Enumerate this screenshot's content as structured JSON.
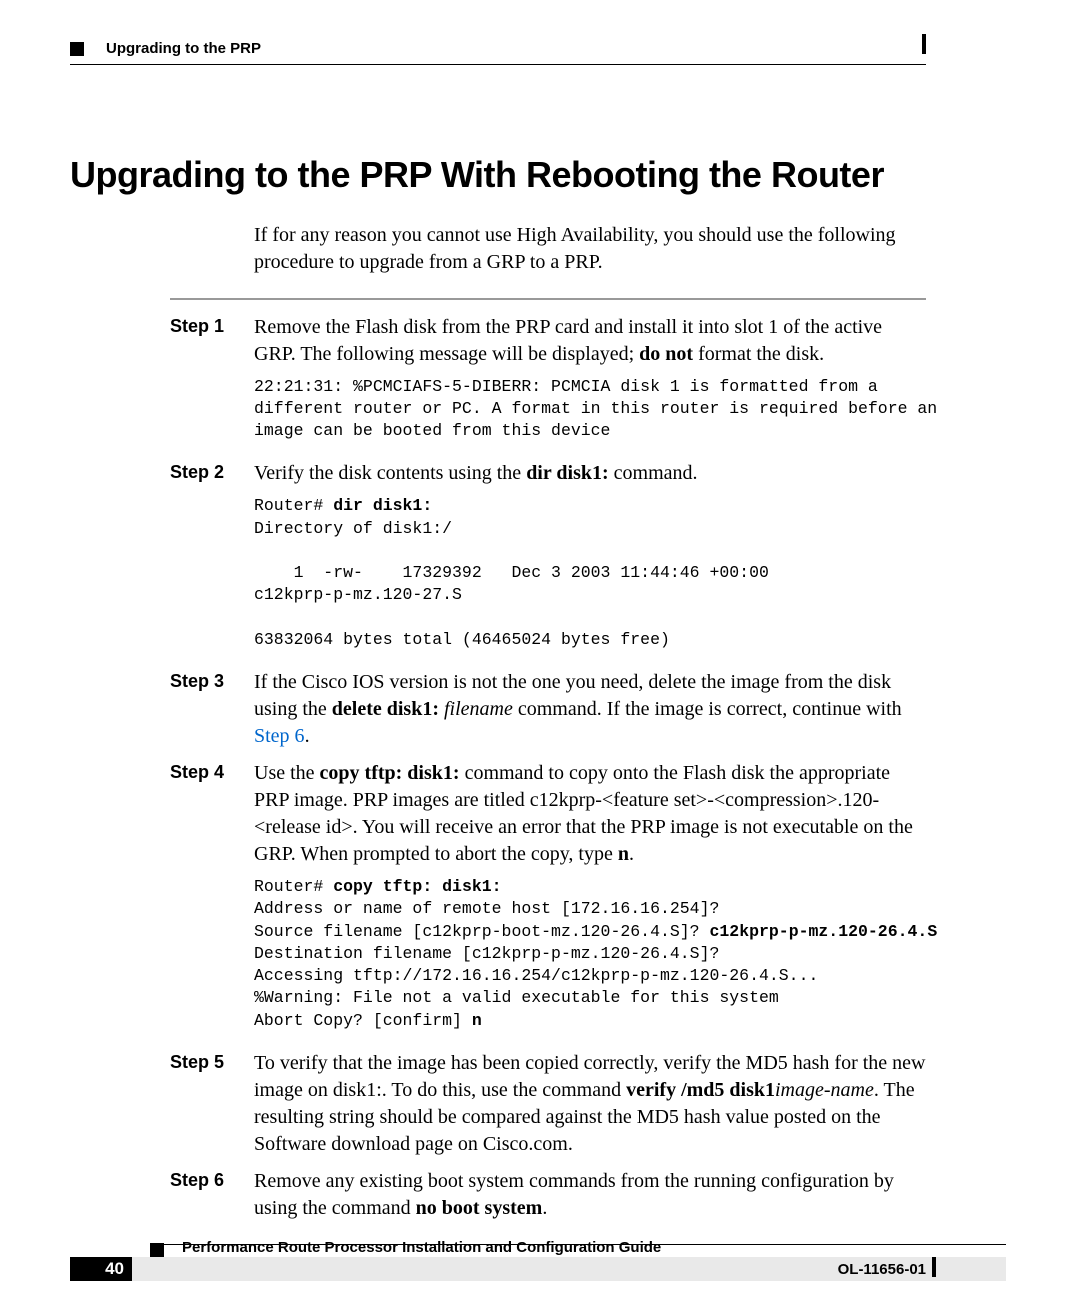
{
  "header": {
    "breadcrumb": "Upgrading to the PRP"
  },
  "title": "Upgrading to the PRP With Rebooting the Router",
  "intro": "If for any reason you cannot use High Availability, you should use the following procedure to upgrade from a GRP to a PRP.",
  "steps": {
    "s1": {
      "label": "Step 1",
      "text_a": "Remove the Flash disk from the PRP card and install it into slot 1 of the active GRP. The following message will be displayed; ",
      "bold_a": "do not",
      "text_b": " format the disk."
    },
    "s2": {
      "label": "Step 2",
      "text_a": "Verify the disk contents using the ",
      "bold_a": "dir disk1:",
      "text_b": " command."
    },
    "s3": {
      "label": "Step 3",
      "text_a": "If the Cisco IOS version is not the one you need, delete the image from the disk using the ",
      "bold_a": "delete disk1:",
      "italic_a": " filename",
      "text_b": " command. If the image is correct, continue with ",
      "link": "Step 6",
      "text_c": "."
    },
    "s4": {
      "label": "Step 4",
      "text_a": "Use the ",
      "bold_a": "copy tftp: disk1:",
      "text_b": " command to copy onto the Flash disk the appropriate PRP image. PRP images are titled c12kprp-<feature set>-<compression>.120-<release id>. You will receive an error that the PRP image is not executable on the GRP. When prompted to abort the copy, type ",
      "bold_b": "n",
      "text_c": "."
    },
    "s5": {
      "label": "Step 5",
      "text_a": "To verify that the image has been copied correctly, verify the MD5 hash for the new image on disk1:. To do this, use the command ",
      "bold_a": "verify /md5 disk1",
      "italic_a": "image-name",
      "text_b": ". The resulting string should be compared against the MD5 hash value posted on the Software download page on Cisco.com."
    },
    "s6": {
      "label": "Step 6",
      "text_a": "Remove any existing boot system commands from the running configuration by using the command ",
      "bold_a": "no boot system",
      "text_b": "."
    }
  },
  "code": {
    "c1": "22:21:31: %PCMCIAFS-5-DIBERR: PCMCIA disk 1 is formatted from a\ndifferent router or PC. A format in this router is required before an\nimage can be booted from this device",
    "c2_prompt": "Router# ",
    "c2_cmd": "dir disk1:",
    "c2_rest": "\nDirectory of disk1:/\n\n    1  -rw-    17329392   Dec 3 2003 11:44:46 +00:00\nc12kprp-p-mz.120-27.S\n\n63832064 bytes total (46465024 bytes free)",
    "c3_prompt": "Router# ",
    "c3_cmd": "copy tftp: disk1:",
    "c3_l1": "\nAddress or name of remote host [172.16.16.254]?",
    "c3_l2a": "\nSource filename [c12kprp-boot-mz.120-26.4.S]? ",
    "c3_l2b": "c12kprp-p-mz.120-26.4.S",
    "c3_l3": "\nDestination filename [c12kprp-p-mz.120-26.4.S]?",
    "c3_l4": "\nAccessing tftp://172.16.16.254/c12kprp-p-mz.120-26.4.S...",
    "c3_l5": "\n%Warning: File not a valid executable for this system",
    "c3_l6a": "\nAbort Copy? [confirm] ",
    "c3_l6b": "n"
  },
  "footer": {
    "guide_title": "Performance Route Processor Installation and Configuration Guide",
    "page_number": "40",
    "doc_id": "OL-11656-01"
  }
}
